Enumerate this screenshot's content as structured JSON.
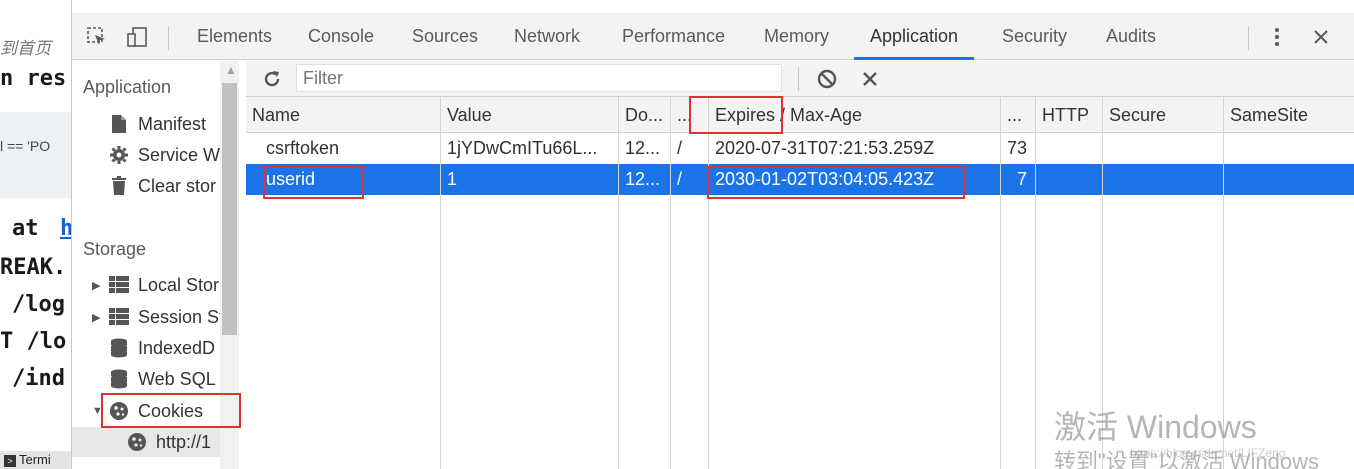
{
  "background_editor": {
    "lines": [
      "到首页",
      "n res",
      "l == 'PO",
      "at",
      "h",
      "REAK.",
      "/log",
      "T /lo",
      "/ind"
    ],
    "terminal_label": "Termi"
  },
  "tabs": [
    {
      "label": "Elements",
      "active": false
    },
    {
      "label": "Console",
      "active": false
    },
    {
      "label": "Sources",
      "active": false
    },
    {
      "label": "Network",
      "active": false
    },
    {
      "label": "Performance",
      "active": false
    },
    {
      "label": "Memory",
      "active": false
    },
    {
      "label": "Application",
      "active": true
    },
    {
      "label": "Security",
      "active": false
    },
    {
      "label": "Audits",
      "active": false
    }
  ],
  "sidebar": {
    "application_heading": "Application",
    "application_items": [
      {
        "label": "Manifest",
        "icon": "document-icon"
      },
      {
        "label": "Service W",
        "icon": "gear-icon"
      },
      {
        "label": "Clear stor",
        "icon": "trash-icon"
      }
    ],
    "storage_heading": "Storage",
    "storage_items": [
      {
        "label": "Local Stor",
        "icon": "grid-icon",
        "expandable": true
      },
      {
        "label": "Session St",
        "icon": "grid-icon",
        "expandable": true
      },
      {
        "label": "IndexedD",
        "icon": "database-icon",
        "expandable": false
      },
      {
        "label": "Web SQL",
        "icon": "database-icon",
        "expandable": false
      },
      {
        "label": "Cookies",
        "icon": "cookie-icon",
        "expandable": true,
        "expanded": true
      },
      {
        "label": "http://1",
        "icon": "cookie-icon",
        "expandable": false,
        "selected": true
      }
    ]
  },
  "toolbar": {
    "filter_placeholder": "Filter",
    "refresh_icon": "refresh-icon",
    "block_icon": "block-icon",
    "clear_icon": "close-icon"
  },
  "cookies_table": {
    "columns": [
      "Name",
      "Value",
      "Do...",
      "...",
      "Expires / Max-Age",
      "...",
      "HTTP",
      "Secure",
      "SameSite"
    ],
    "rows": [
      {
        "name": "csrftoken",
        "value": "1jYDwCmITu66L...",
        "domain": "12...",
        "path": "/",
        "expires": "2020-07-31T07:21:53.259Z",
        "size": "73",
        "http": "",
        "secure": "",
        "samesite": "",
        "selected": false
      },
      {
        "name": "userid",
        "value": "1",
        "domain": "12...",
        "path": "/",
        "expires": "2030-01-02T03:04:05.423Z",
        "size": "7",
        "http": "",
        "secure": "",
        "samesite": "",
        "selected": true
      }
    ]
  },
  "watermark": {
    "line1": "激活 Windows",
    "line2": "转到\"设置\"以激活 Windows",
    "url": "https://blog.csdn.net/LIFZeng"
  },
  "colors": {
    "accent": "#1a73e8",
    "highlight_box": "#e03131"
  }
}
